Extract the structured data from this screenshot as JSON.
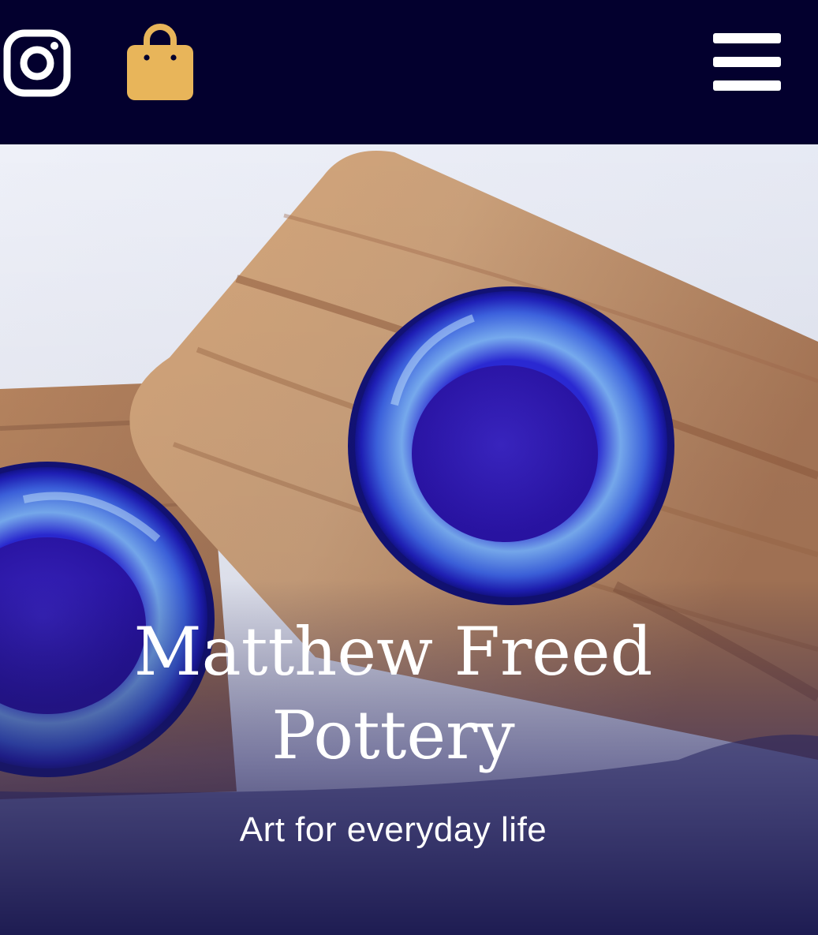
{
  "header": {
    "background": "#03002e",
    "icons": {
      "instagram": "instagram-icon",
      "bag": "shopping-bag-icon",
      "menu": "hamburger-menu-icon"
    },
    "bag_color": "#e8b55a"
  },
  "hero": {
    "title_line1": "Matthew Freed",
    "title_line2": "Pottery",
    "tagline": "Art for everyday life",
    "accent": "#2a2bd6"
  }
}
